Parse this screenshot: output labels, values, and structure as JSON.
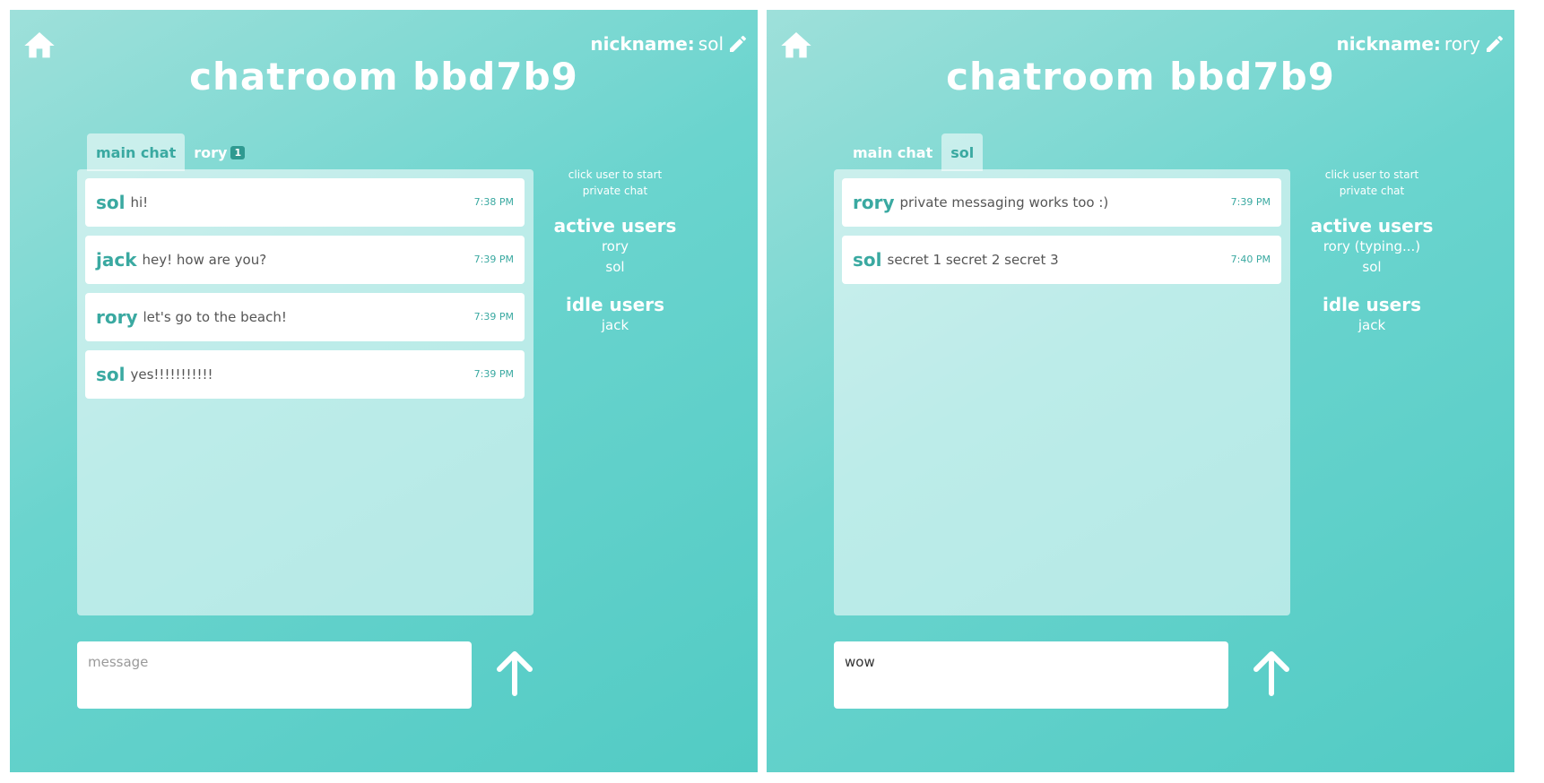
{
  "colors": {
    "accent": "#3aa9a1",
    "background_start": "#9ee0da",
    "background_end": "#52cbc4",
    "white": "#ffffff"
  },
  "panels": [
    {
      "home_icon": "home-icon",
      "nickname_label": "nickname:",
      "nickname_value": "sol",
      "edit_icon": "pencil-icon",
      "title": "chatroom bbd7b9",
      "tabs": [
        {
          "label": "main chat",
          "active": true,
          "badge": ""
        },
        {
          "label": "rory",
          "active": false,
          "badge": "1"
        }
      ],
      "messages": [
        {
          "user": "sol",
          "text": "hi!",
          "time": "7:38 PM"
        },
        {
          "user": "jack",
          "text": "hey! how are you?",
          "time": "7:39 PM"
        },
        {
          "user": "rory",
          "text": "let's go to the beach!",
          "time": "7:39 PM"
        },
        {
          "user": "sol",
          "text": "yes!!!!!!!!!!!",
          "time": "7:39 PM"
        }
      ],
      "hint": "click user to start private chat",
      "active_users_label": "active users",
      "active_users": [
        "rory",
        "sol"
      ],
      "idle_users_label": "idle users",
      "idle_users": [
        "jack"
      ],
      "input_placeholder": "message",
      "input_value": "",
      "send_icon": "arrow-up-icon"
    },
    {
      "home_icon": "home-icon",
      "nickname_label": "nickname:",
      "nickname_value": "rory",
      "edit_icon": "pencil-icon",
      "title": "chatroom bbd7b9",
      "tabs": [
        {
          "label": "main chat",
          "active": false,
          "badge": ""
        },
        {
          "label": "sol",
          "active": true,
          "badge": ""
        }
      ],
      "messages": [
        {
          "user": "rory",
          "text": "private messaging works too :)",
          "time": "7:39 PM"
        },
        {
          "user": "sol",
          "text": "secret 1 secret 2 secret 3",
          "time": "7:40 PM"
        }
      ],
      "hint": "click user to start private chat",
      "active_users_label": "active users",
      "active_users": [
        "rory (typing...)",
        "sol"
      ],
      "idle_users_label": "idle users",
      "idle_users": [
        "jack"
      ],
      "input_placeholder": "message",
      "input_value": "wow",
      "send_icon": "arrow-up-icon"
    }
  ]
}
